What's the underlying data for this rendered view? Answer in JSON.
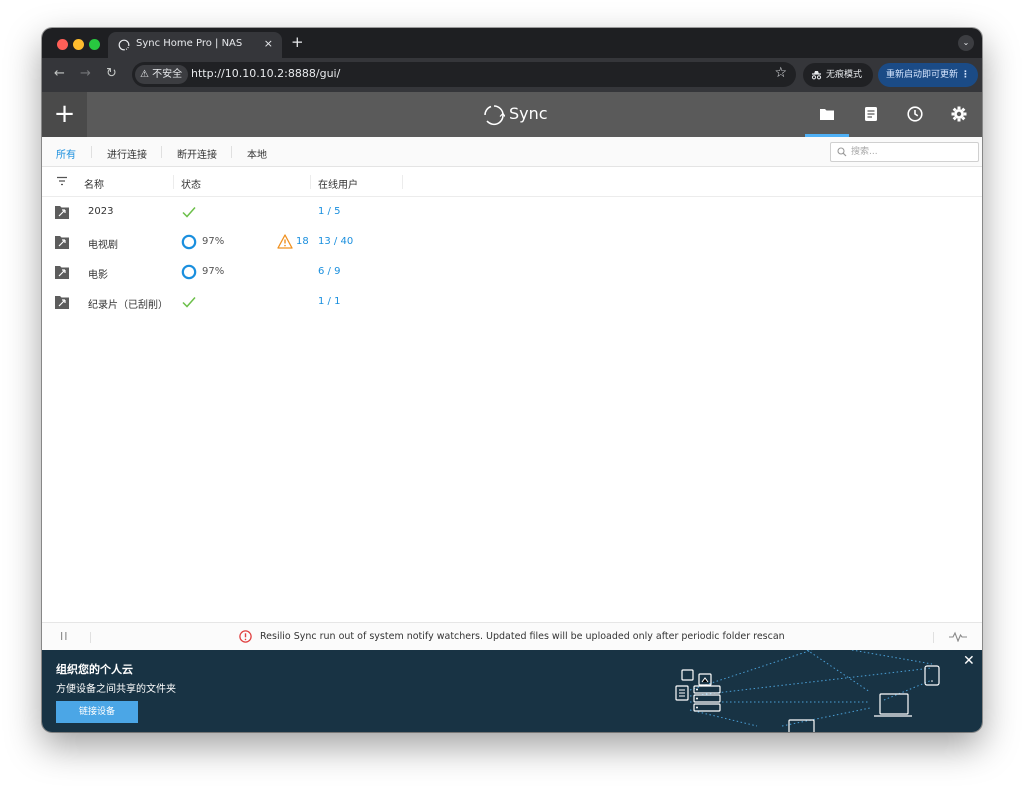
{
  "browser": {
    "tab_title": "Sync Home Pro | NAS",
    "tab_close": "×",
    "new_tab": "+",
    "security_label": "⚠ 不安全",
    "url": "http://10.10.10.2:8888/gui/",
    "incognito_label": "无痕模式",
    "update_label": "重新启动即可更新"
  },
  "header": {
    "add_label": "+",
    "logo_text": "Sync",
    "active_icon": "folder-icon",
    "icons": [
      "folder-icon",
      "document-icon",
      "clock-icon",
      "gear-icon"
    ]
  },
  "filters": {
    "all": "所有",
    "connecting": "进行连接",
    "disconnected": "断开连接",
    "local": "本地",
    "search_placeholder": "搜索..."
  },
  "table": {
    "columns": [
      "名称",
      "状态",
      "在线用户"
    ],
    "rows": [
      {
        "name": "2023",
        "status": "synced",
        "percent": "",
        "warnings": "",
        "peers": "1 / 5"
      },
      {
        "name": "电视剧",
        "status": "syncing",
        "percent": "97%",
        "warnings": "18",
        "peers": "13 / 40"
      },
      {
        "name": "电影",
        "status": "syncing",
        "percent": "97%",
        "warnings": "",
        "peers": "6 / 9"
      },
      {
        "name": "纪录片（已刮削）",
        "status": "synced",
        "percent": "",
        "warnings": "",
        "peers": "1 / 1"
      }
    ]
  },
  "status_bar": {
    "pause_label": "II",
    "message": "Resilio Sync run out of system notify watchers. Updated files will be uploaded only after periodic folder rescan"
  },
  "banner": {
    "title": "组织您的个人云",
    "subtitle": "方便设备之间共享的文件夹",
    "button": "链接设备",
    "close": "✕"
  },
  "colors": {
    "accent": "#1a8fde",
    "check": "#6cc04a",
    "warning": "#f0901e",
    "error": "#e04040",
    "header_bg": "#5a5a5a",
    "banner_bg": "#183344"
  }
}
